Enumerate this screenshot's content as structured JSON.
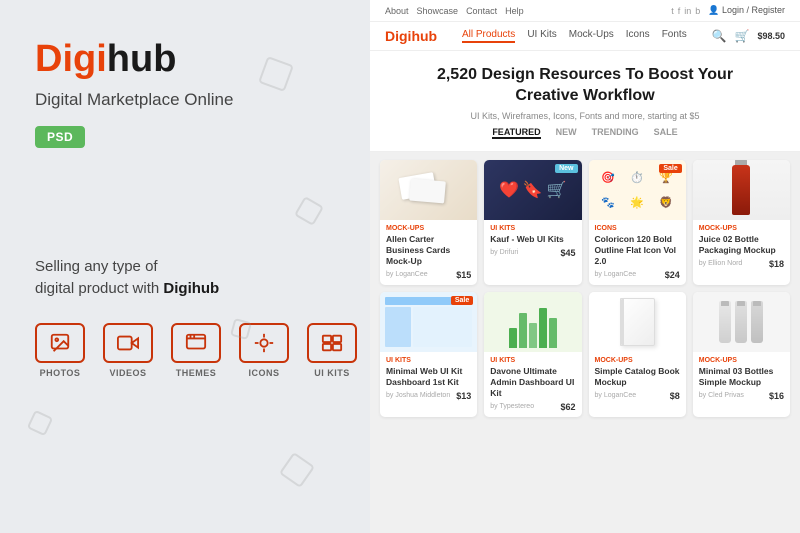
{
  "left": {
    "logo_prefix": "Digi",
    "logo_suffix": "hub",
    "tagline": "Digital Marketplace Online",
    "badge": "PSD",
    "selling_text_1": "Selling any type of",
    "selling_text_2": "digital product with ",
    "selling_brand": "Digihub",
    "icons": [
      {
        "label": "PHOTOS",
        "icon": "photo"
      },
      {
        "label": "VIDEOS",
        "icon": "video"
      },
      {
        "label": "THEMES",
        "icon": "theme"
      },
      {
        "label": "ICONS",
        "icon": "icon"
      },
      {
        "label": "UI KITS",
        "icon": "uikit"
      }
    ]
  },
  "right": {
    "topbar": {
      "links": [
        "About",
        "Showcase",
        "Contact",
        "Help"
      ],
      "social": [
        "t",
        "f",
        "in",
        "b"
      ],
      "login": "Login / Register"
    },
    "nav": {
      "logo_prefix": "Digi",
      "logo_suffix": "hub",
      "links": [
        "All Products",
        "UI Kits",
        "Mock-Ups",
        "Icons",
        "Fonts"
      ],
      "active_link": "All Products",
      "cart_price": "$98.50"
    },
    "hero": {
      "title": "2,520 Design Resources To Boost Your",
      "title2": "Creative Workflow",
      "subtitle": "UI Kits, Wireframes, Icons, Fonts and more, starting at $5",
      "tabs": [
        "FEATURED",
        "NEW",
        "TRENDING",
        "SALE"
      ],
      "active_tab": "FEATURED"
    },
    "products": [
      {
        "id": 1,
        "category": "MOCK-UPS",
        "name": "Allen Carter Business Cards Mock-Up",
        "author": "by LoganCee",
        "price": "$15",
        "badge": "",
        "thumb_class": "thumb-1"
      },
      {
        "id": 2,
        "category": "UI KITS",
        "name": "Kauf - Web UI Kits",
        "author": "by Drifuri",
        "price": "$45",
        "badge": "New",
        "badge_type": "new",
        "thumb_class": "thumb-2"
      },
      {
        "id": 3,
        "category": "ICONS",
        "name": "Coloricon 120 Bold Outline Flat Icon Vol 2.0",
        "author": "by LoganCee",
        "price": "$24",
        "badge": "Sale",
        "badge_type": "sale",
        "thumb_class": "thumb-3"
      },
      {
        "id": 4,
        "category": "MOCK-UPS",
        "name": "Juice 02 Bottle Packaging Mockup",
        "author": "by Ellion Nord",
        "price": "$18",
        "badge": "",
        "thumb_class": "thumb-4"
      },
      {
        "id": 5,
        "category": "UI KITS",
        "name": "Minimal Web UI Kit Dashboard 1st Kit",
        "author": "by Joshua Middleton",
        "price": "$13",
        "badge": "Sale",
        "badge_type": "sale",
        "thumb_class": "thumb-5"
      },
      {
        "id": 6,
        "category": "UI KITS",
        "name": "Davone Ultimate Admin Dashboard UI Kit",
        "author": "by Typestereo",
        "price": "$62",
        "badge": "",
        "thumb_class": "thumb-6"
      },
      {
        "id": 7,
        "category": "MOCK-UPS",
        "name": "Simple Catalog Book Mockup",
        "author": "by LoganCee",
        "price": "$8",
        "badge": "",
        "thumb_class": "thumb-7"
      },
      {
        "id": 8,
        "category": "MOCK-UPS",
        "name": "Minimal 03 Bottles Simple Mockup",
        "author": "by Cled Privas",
        "price": "$16",
        "badge": "",
        "thumb_class": "thumb-8"
      }
    ]
  }
}
